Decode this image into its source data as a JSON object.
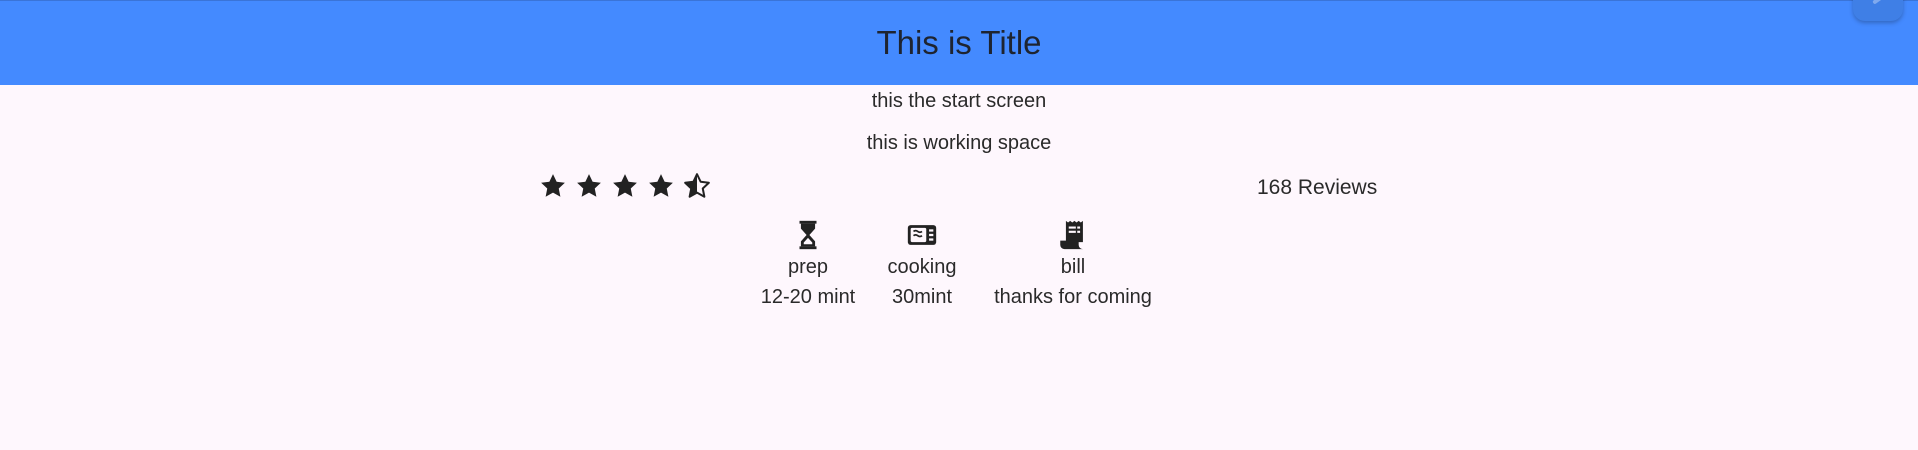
{
  "appbar": {
    "title": "This is Title",
    "color": "#448aff"
  },
  "content": {
    "line1": "this the start screen",
    "line2": "this is working space"
  },
  "rating": {
    "value": 4.5,
    "max": 5,
    "reviews_label": "168 Reviews"
  },
  "info": [
    {
      "icon": "hourglass-icon",
      "title": "prep",
      "value": "12-20 mint"
    },
    {
      "icon": "microwave-icon",
      "title": "cooking",
      "value": "30mint"
    },
    {
      "icon": "receipt-icon",
      "title": "bill",
      "value": "thanks for coming"
    }
  ]
}
